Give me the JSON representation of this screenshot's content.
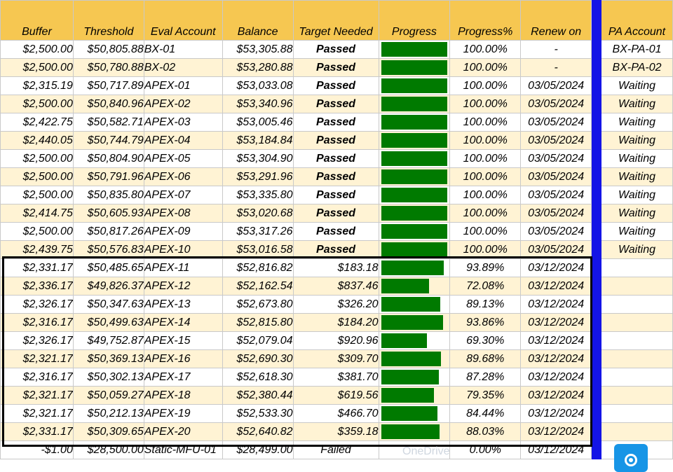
{
  "headers": {
    "buffer": "Buffer",
    "threshold": "Threshold",
    "eval_account": "Eval Account",
    "balance": "Balance",
    "target_needed": "Target Needed",
    "progress": "Progress",
    "progress_pct": "Progress%",
    "renew_on": "Renew on",
    "pa_account": "PA Account"
  },
  "rows": [
    {
      "buffer": "$2,500.00",
      "threshold": "$50,805.88",
      "eval": "BX-01",
      "balance": "$53,305.88",
      "target": "Passed",
      "status": "passed",
      "progress": 1.0,
      "pct": "100.00%",
      "renew": "-",
      "pa": "BX-PA-01"
    },
    {
      "buffer": "$2,500.00",
      "threshold": "$50,780.88",
      "eval": "BX-02",
      "balance": "$53,280.88",
      "target": "Passed",
      "status": "passed",
      "progress": 1.0,
      "pct": "100.00%",
      "renew": "-",
      "pa": "BX-PA-02"
    },
    {
      "buffer": "$2,315.19",
      "threshold": "$50,717.89",
      "eval": "APEX-01",
      "balance": "$53,033.08",
      "target": "Passed",
      "status": "passed",
      "progress": 1.0,
      "pct": "100.00%",
      "renew": "03/05/2024",
      "pa": "Waiting"
    },
    {
      "buffer": "$2,500.00",
      "threshold": "$50,840.96",
      "eval": "APEX-02",
      "balance": "$53,340.96",
      "target": "Passed",
      "status": "passed",
      "progress": 1.0,
      "pct": "100.00%",
      "renew": "03/05/2024",
      "pa": "Waiting"
    },
    {
      "buffer": "$2,422.75",
      "threshold": "$50,582.71",
      "eval": "APEX-03",
      "balance": "$53,005.46",
      "target": "Passed",
      "status": "passed",
      "progress": 1.0,
      "pct": "100.00%",
      "renew": "03/05/2024",
      "pa": "Waiting"
    },
    {
      "buffer": "$2,440.05",
      "threshold": "$50,744.79",
      "eval": "APEX-04",
      "balance": "$53,184.84",
      "target": "Passed",
      "status": "passed",
      "progress": 1.0,
      "pct": "100.00%",
      "renew": "03/05/2024",
      "pa": "Waiting"
    },
    {
      "buffer": "$2,500.00",
      "threshold": "$50,804.90",
      "eval": "APEX-05",
      "balance": "$53,304.90",
      "target": "Passed",
      "status": "passed",
      "progress": 1.0,
      "pct": "100.00%",
      "renew": "03/05/2024",
      "pa": "Waiting"
    },
    {
      "buffer": "$2,500.00",
      "threshold": "$50,791.96",
      "eval": "APEX-06",
      "balance": "$53,291.96",
      "target": "Passed",
      "status": "passed",
      "progress": 1.0,
      "pct": "100.00%",
      "renew": "03/05/2024",
      "pa": "Waiting"
    },
    {
      "buffer": "$2,500.00",
      "threshold": "$50,835.80",
      "eval": "APEX-07",
      "balance": "$53,335.80",
      "target": "Passed",
      "status": "passed",
      "progress": 1.0,
      "pct": "100.00%",
      "renew": "03/05/2024",
      "pa": "Waiting"
    },
    {
      "buffer": "$2,414.75",
      "threshold": "$50,605.93",
      "eval": "APEX-08",
      "balance": "$53,020.68",
      "target": "Passed",
      "status": "passed",
      "progress": 1.0,
      "pct": "100.00%",
      "renew": "03/05/2024",
      "pa": "Waiting"
    },
    {
      "buffer": "$2,500.00",
      "threshold": "$50,817.26",
      "eval": "APEX-09",
      "balance": "$53,317.26",
      "target": "Passed",
      "status": "passed",
      "progress": 1.0,
      "pct": "100.00%",
      "renew": "03/05/2024",
      "pa": "Waiting"
    },
    {
      "buffer": "$2,439.75",
      "threshold": "$50,576.83",
      "eval": "APEX-10",
      "balance": "$53,016.58",
      "target": "Passed",
      "status": "passed",
      "progress": 1.0,
      "pct": "100.00%",
      "renew": "03/05/2024",
      "pa": "Waiting"
    },
    {
      "buffer": "$2,331.17",
      "threshold": "$50,485.65",
      "eval": "APEX-11",
      "balance": "$52,816.82",
      "target": "$183.18",
      "status": "amount",
      "progress": 0.9389,
      "pct": "93.89%",
      "renew": "03/12/2024",
      "pa": ""
    },
    {
      "buffer": "$2,336.17",
      "threshold": "$49,826.37",
      "eval": "APEX-12",
      "balance": "$52,162.54",
      "target": "$837.46",
      "status": "amount",
      "progress": 0.7208,
      "pct": "72.08%",
      "renew": "03/12/2024",
      "pa": ""
    },
    {
      "buffer": "$2,326.17",
      "threshold": "$50,347.63",
      "eval": "APEX-13",
      "balance": "$52,673.80",
      "target": "$326.20",
      "status": "amount",
      "progress": 0.8913,
      "pct": "89.13%",
      "renew": "03/12/2024",
      "pa": ""
    },
    {
      "buffer": "$2,316.17",
      "threshold": "$50,499.63",
      "eval": "APEX-14",
      "balance": "$52,815.80",
      "target": "$184.20",
      "status": "amount",
      "progress": 0.9386,
      "pct": "93.86%",
      "renew": "03/12/2024",
      "pa": ""
    },
    {
      "buffer": "$2,326.17",
      "threshold": "$49,752.87",
      "eval": "APEX-15",
      "balance": "$52,079.04",
      "target": "$920.96",
      "status": "amount",
      "progress": 0.693,
      "pct": "69.30%",
      "renew": "03/12/2024",
      "pa": ""
    },
    {
      "buffer": "$2,321.17",
      "threshold": "$50,369.13",
      "eval": "APEX-16",
      "balance": "$52,690.30",
      "target": "$309.70",
      "status": "amount",
      "progress": 0.8968,
      "pct": "89.68%",
      "renew": "03/12/2024",
      "pa": ""
    },
    {
      "buffer": "$2,316.17",
      "threshold": "$50,302.13",
      "eval": "APEX-17",
      "balance": "$52,618.30",
      "target": "$381.70",
      "status": "amount",
      "progress": 0.8728,
      "pct": "87.28%",
      "renew": "03/12/2024",
      "pa": ""
    },
    {
      "buffer": "$2,321.17",
      "threshold": "$50,059.27",
      "eval": "APEX-18",
      "balance": "$52,380.44",
      "target": "$619.56",
      "status": "amount",
      "progress": 0.7935,
      "pct": "79.35%",
      "renew": "03/12/2024",
      "pa": ""
    },
    {
      "buffer": "$2,321.17",
      "threshold": "$50,212.13",
      "eval": "APEX-19",
      "balance": "$52,533.30",
      "target": "$466.70",
      "status": "amount",
      "progress": 0.8444,
      "pct": "84.44%",
      "renew": "03/12/2024",
      "pa": ""
    },
    {
      "buffer": "$2,331.17",
      "threshold": "$50,309.65",
      "eval": "APEX-20",
      "balance": "$52,640.82",
      "target": "$359.18",
      "status": "amount",
      "progress": 0.8803,
      "pct": "88.03%",
      "renew": "03/12/2024",
      "pa": ""
    },
    {
      "buffer": "-$1.00",
      "threshold": "$28,500.00",
      "eval": "Static-MFU-01",
      "balance": "$28,499.00",
      "target": "Failed",
      "status": "failed",
      "progress": 0.0,
      "pct": "0.00%",
      "renew": "03/12/2024",
      "pa": ""
    }
  ],
  "overlay": {
    "text": "OneDrive",
    "button_icon": "target-icon"
  },
  "colors": {
    "header": "#f6c751",
    "alt_row": "#fff3d4",
    "progress_fill": "#007a00",
    "passed_text": "#0b5e20",
    "failed_text": "#e00000",
    "separator": "#1414e6",
    "float_button": "#1795e6"
  }
}
